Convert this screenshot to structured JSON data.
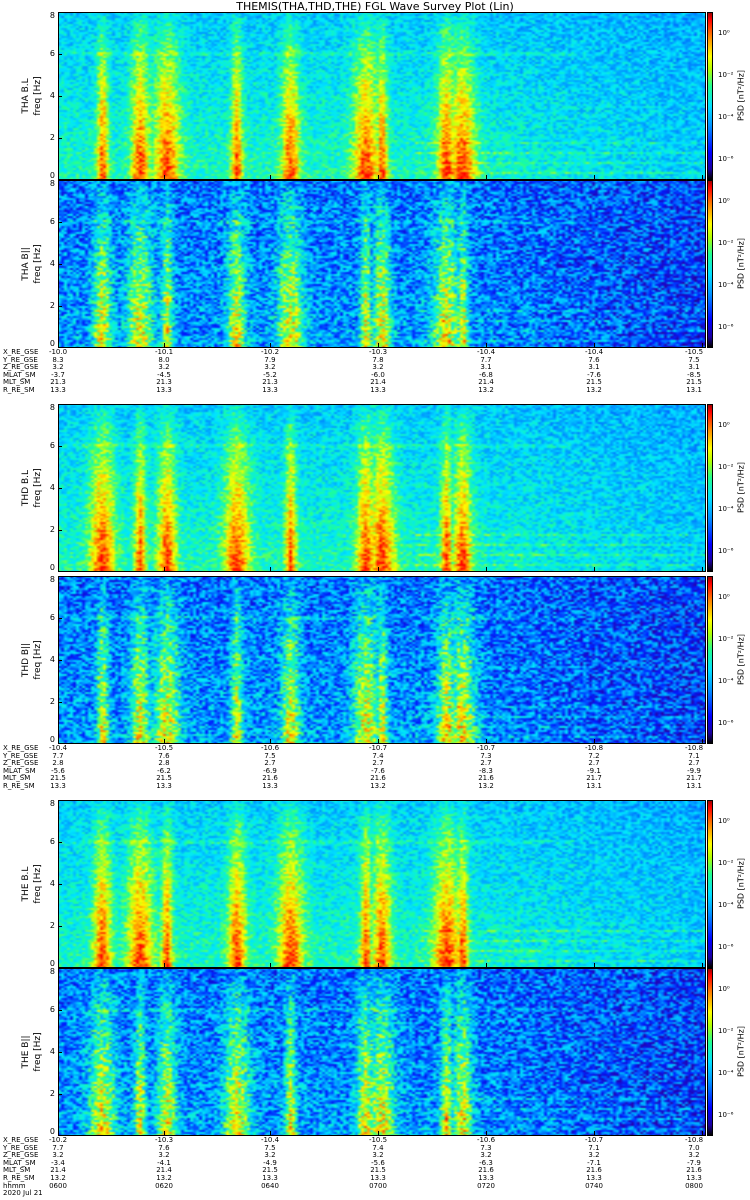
{
  "title": "THEMIS(THA,THD,THE) FGL Wave Survey Plot (Lin)",
  "yaxis": {
    "ticks": [
      "0",
      "2",
      "4",
      "6",
      "8"
    ],
    "unit": "freq [Hz]",
    "max": 8
  },
  "colorbar": {
    "label": "PSD [nT²/Hz]",
    "ticks": [
      "10⁰",
      "10⁻²",
      "10⁻⁴",
      "10⁻⁶"
    ],
    "top_exp": 1,
    "bottom_exp": -7
  },
  "panels": [
    {
      "name": "THA B.L",
      "ylabel": "THA B.L"
    },
    {
      "name": "THA B||",
      "ylabel": "THA B||"
    },
    {
      "name": "THD B.L",
      "ylabel": "THD B.L"
    },
    {
      "name": "THD B||",
      "ylabel": "THD B||"
    },
    {
      "name": "THE B.L",
      "ylabel": "THE B.L"
    },
    {
      "name": "THE B||",
      "ylabel": "THE B||"
    }
  ],
  "ephemeris": [
    {
      "probe": "THA",
      "rows": [
        {
          "label": "X_RE_GSE",
          "values": [
            "-10.0",
            "-10.1",
            "-10.2",
            "-10.3",
            "-10.4",
            "-10.4",
            "-10.5"
          ]
        },
        {
          "label": "Y_RE_GSE",
          "values": [
            "8.3",
            "8.0",
            "7.9",
            "7.8",
            "7.7",
            "7.6",
            "7.5"
          ]
        },
        {
          "label": "Z_RE_GSE",
          "values": [
            "3.2",
            "3.2",
            "3.2",
            "3.2",
            "3.1",
            "3.1",
            "3.1"
          ]
        },
        {
          "label": "MLAT_SM",
          "values": [
            "-3.7",
            "-4.5",
            "-5.2",
            "-6.0",
            "-6.8",
            "-7.6",
            "-8.5"
          ]
        },
        {
          "label": "MLT_SM",
          "values": [
            "21.3",
            "21.3",
            "21.3",
            "21.4",
            "21.4",
            "21.5",
            "21.5"
          ]
        },
        {
          "label": "R_RE_SM",
          "values": [
            "13.3",
            "13.3",
            "13.3",
            "13.3",
            "13.2",
            "13.2",
            "13.1"
          ]
        }
      ]
    },
    {
      "probe": "THD",
      "rows": [
        {
          "label": "X_RE_GSE",
          "values": [
            "-10.4",
            "-10.5",
            "-10.6",
            "-10.7",
            "-10.7",
            "-10.8",
            "-10.8"
          ]
        },
        {
          "label": "Y_RE_GSE",
          "values": [
            "7.7",
            "7.6",
            "7.5",
            "7.4",
            "7.3",
            "7.2",
            "7.1"
          ]
        },
        {
          "label": "Z_RE_GSE",
          "values": [
            "2.8",
            "2.8",
            "2.7",
            "2.7",
            "2.7",
            "2.7",
            "2.7"
          ]
        },
        {
          "label": "MLAT_SM",
          "values": [
            "-5.6",
            "-6.2",
            "-6.9",
            "-7.6",
            "-8.3",
            "-9.1",
            "-9.9"
          ]
        },
        {
          "label": "MLT_SM",
          "values": [
            "21.5",
            "21.5",
            "21.6",
            "21.6",
            "21.6",
            "21.7",
            "21.7"
          ]
        },
        {
          "label": "R_RE_SM",
          "values": [
            "13.3",
            "13.3",
            "13.3",
            "13.2",
            "13.2",
            "13.1",
            "13.1"
          ]
        }
      ]
    },
    {
      "probe": "THE",
      "rows": [
        {
          "label": "X_RE_GSE",
          "values": [
            "-10.2",
            "-10.3",
            "-10.4",
            "-10.5",
            "-10.6",
            "-10.7",
            "-10.8"
          ]
        },
        {
          "label": "Y_RE_GSE",
          "values": [
            "7.7",
            "7.6",
            "7.5",
            "7.4",
            "7.3",
            "7.1",
            "7.0"
          ]
        },
        {
          "label": "Z_RE_GSE",
          "values": [
            "3.2",
            "3.2",
            "3.2",
            "3.2",
            "3.2",
            "3.2",
            "3.2"
          ]
        },
        {
          "label": "MLAT_SM",
          "values": [
            "-3.4",
            "-4.1",
            "-4.9",
            "-5.6",
            "-6.3",
            "-7.1",
            "-7.9"
          ]
        },
        {
          "label": "MLT_SM",
          "values": [
            "21.4",
            "21.4",
            "21.5",
            "21.5",
            "21.6",
            "21.6",
            "21.6"
          ]
        },
        {
          "label": "R_RE_SM",
          "values": [
            "13.2",
            "13.2",
            "13.3",
            "13.3",
            "13.3",
            "13.3",
            "13.3"
          ]
        },
        {
          "label": "hhmm",
          "values": [
            "0600",
            "0620",
            "0640",
            "0700",
            "0720",
            "0740",
            "0800"
          ]
        }
      ]
    }
  ],
  "date": "2020 Jul 21",
  "chart_data": {
    "type": "heatmap",
    "title": "THEMIS(THA,THD,THE) FGL Wave Survey Plot (Lin)",
    "xlabel": "hhmm",
    "x_ticks": [
      "0600",
      "0620",
      "0640",
      "0700",
      "0720",
      "0740",
      "0800"
    ],
    "x_range": [
      "0600",
      "0800"
    ],
    "ylabel": "freq [Hz]",
    "ylim": [
      0,
      8
    ],
    "y_ticks": [
      0,
      2,
      4,
      6,
      8
    ],
    "colorbar_label": "PSD [nT²/Hz]",
    "colorbar_log_range": [
      1e-07,
      10
    ],
    "colorbar_ticks": [
      "10⁰",
      "10⁻²",
      "10⁻⁴",
      "10⁻⁶"
    ],
    "panels": [
      "THA B.L",
      "THA B||",
      "THD B.L",
      "THD B||",
      "THE B.L",
      "THE B||"
    ],
    "broadband_burst_times_hhmm": [
      "0608",
      "0615",
      "0620",
      "0633",
      "0643",
      "0657",
      "0700",
      "0712",
      "0715"
    ],
    "weak_line_freq_hz": 6.0
  }
}
